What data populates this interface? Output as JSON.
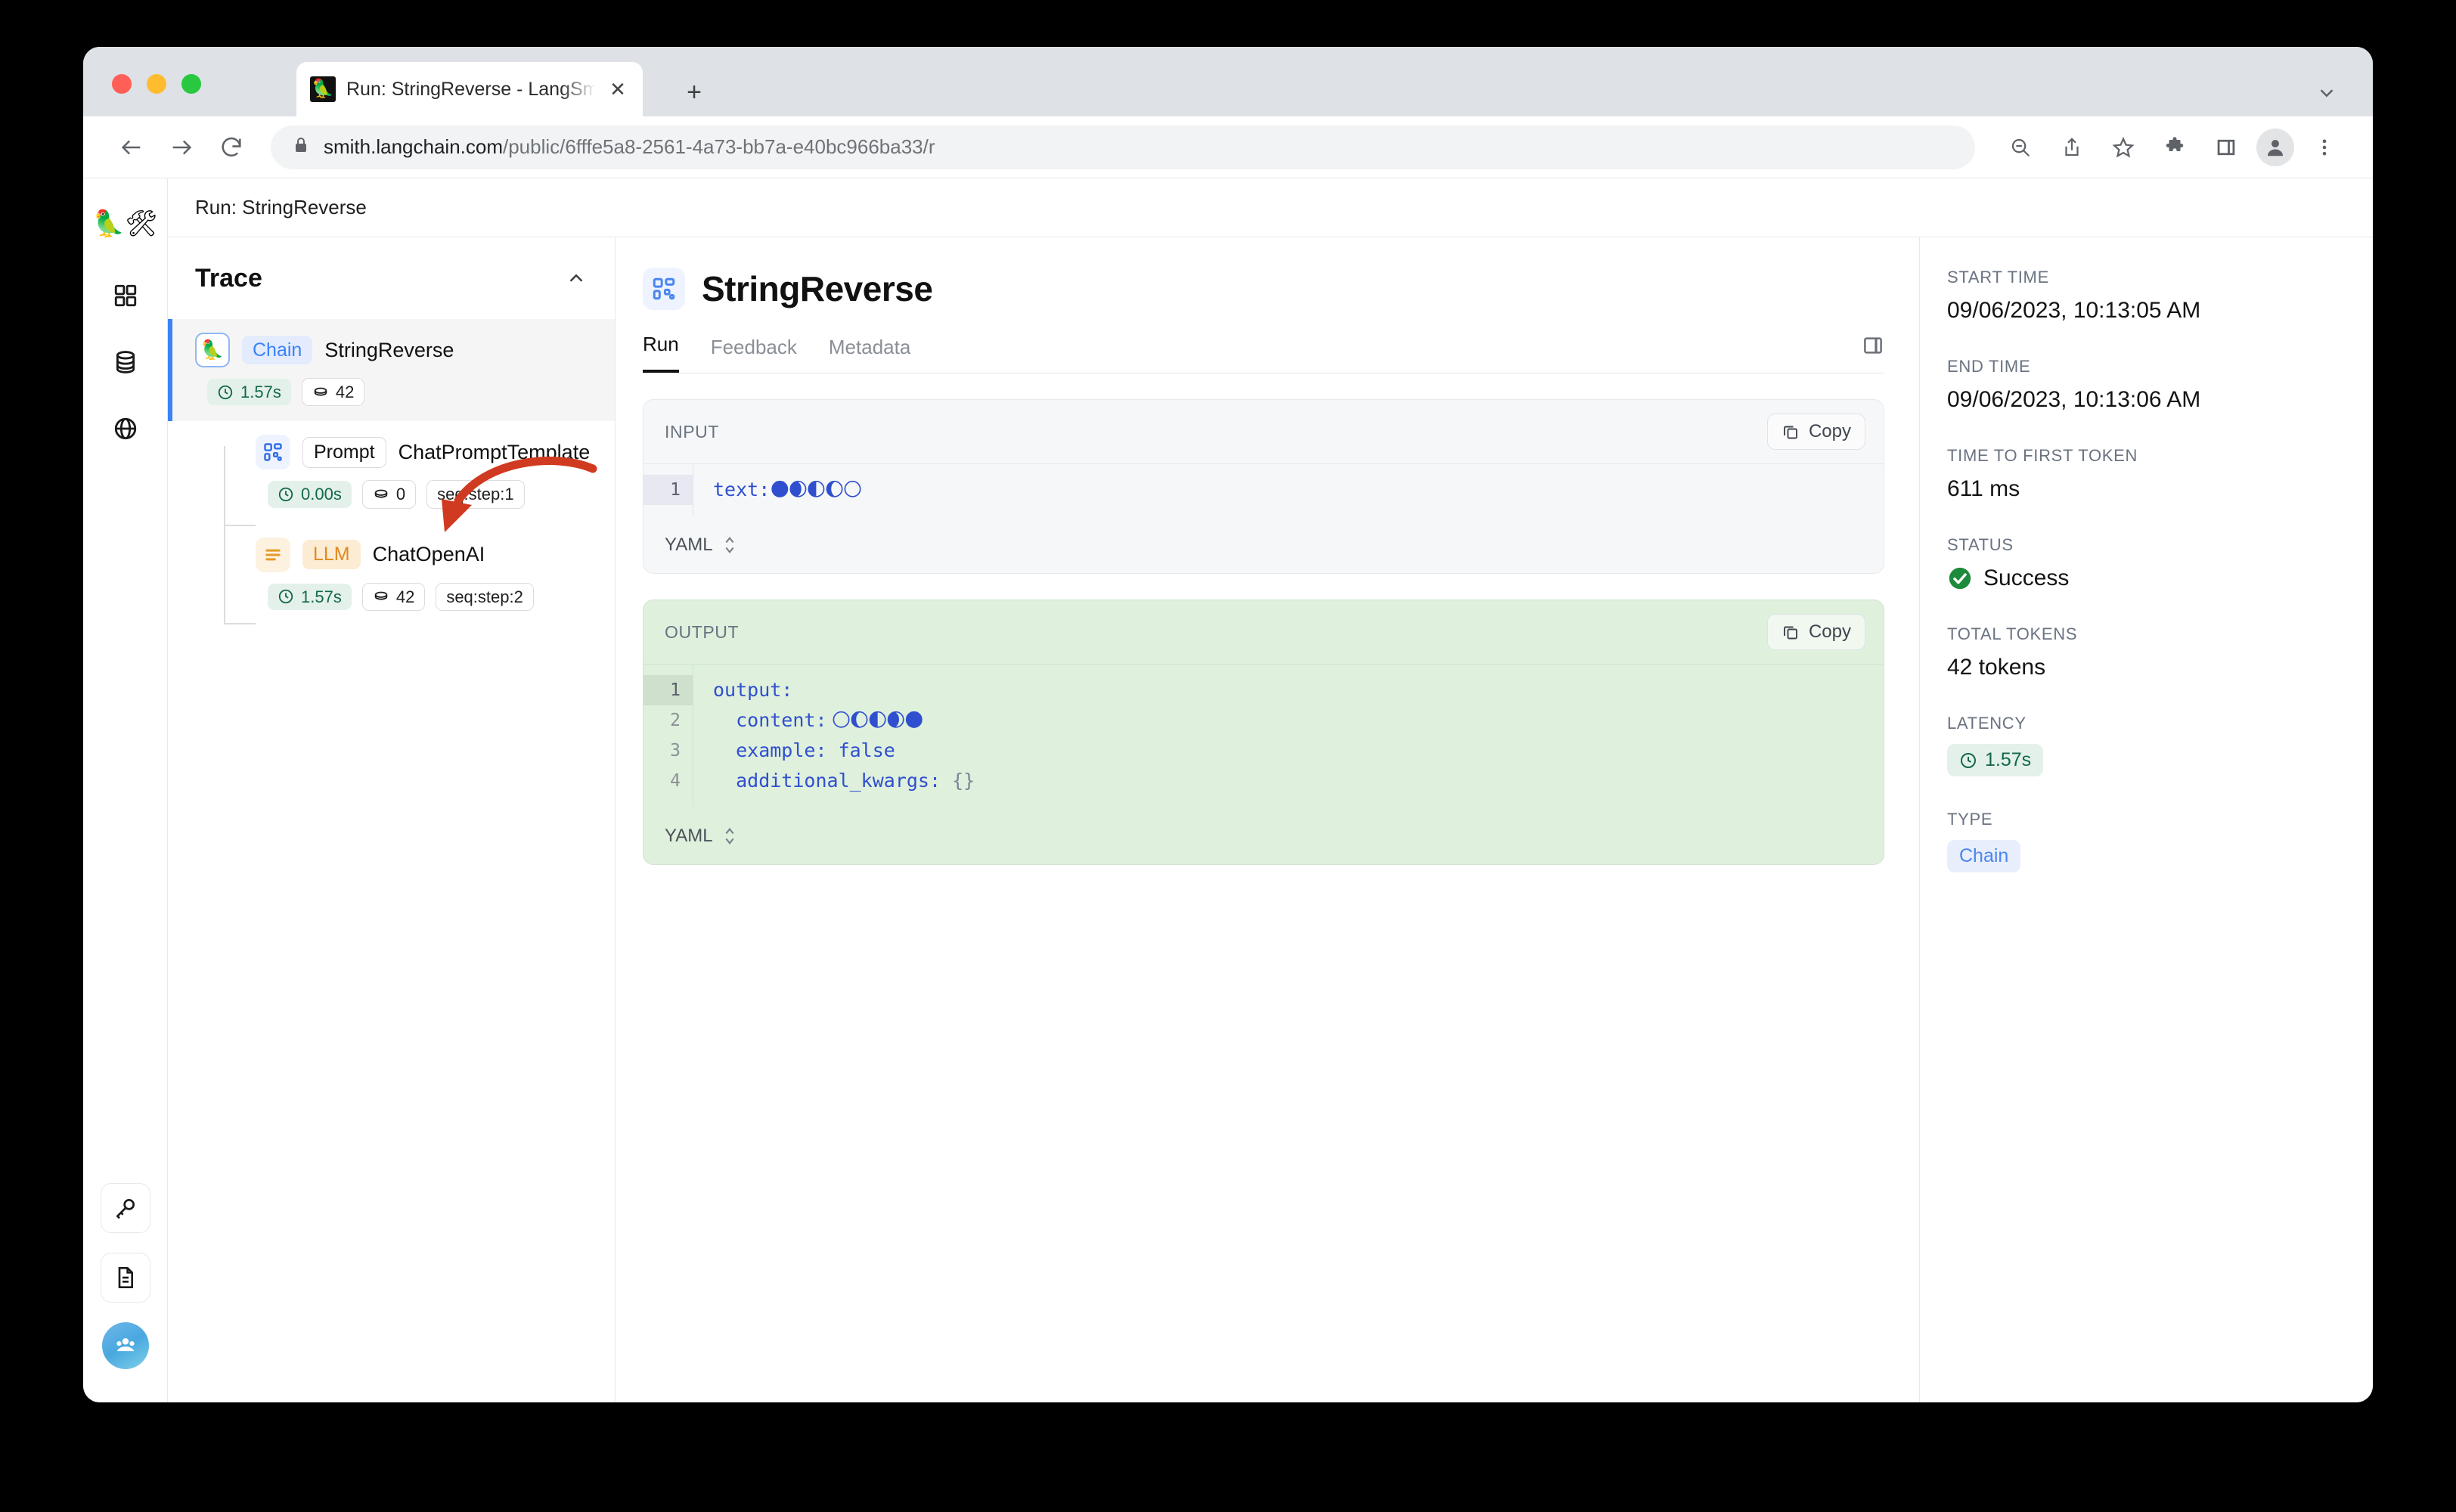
{
  "browser": {
    "tab": {
      "title": "Run: StringReverse - LangSmith",
      "favicon": "🦜",
      "close_label": "✕"
    },
    "new_tab_label": "+",
    "url_prefix": "smith.langchain.com",
    "url_suffix": "/public/6fffe5a8-2561-4a73-bb7a-e40bc966ba33/r",
    "icons": {
      "back": "back-arrow-icon",
      "forward": "forward-arrow-icon",
      "reload": "reload-icon",
      "lock": "lock-icon",
      "zoom_out": "zoom-out-icon",
      "share": "share-icon",
      "bookmark": "star-icon",
      "extensions": "puzzle-icon",
      "side_panel": "side-panel-icon",
      "profile": "profile-avatar-icon",
      "tab_list": "chevron-down-icon"
    }
  },
  "rail": {
    "logo": "🦜🛠",
    "items": [
      {
        "name": "projects",
        "icon": "grid-icon"
      },
      {
        "name": "datasets",
        "icon": "database-icon"
      },
      {
        "name": "hub",
        "icon": "globe-icon"
      }
    ],
    "bottom_items": [
      {
        "name": "api-keys",
        "icon": "key-icon"
      },
      {
        "name": "docs",
        "icon": "document-icon"
      }
    ],
    "avatar": "org-avatar-icon"
  },
  "breadcrumb": "Run: StringReverse",
  "trace": {
    "title": "Trace",
    "collapse_icon": "chevron-up-icon",
    "nodes": [
      {
        "icon": "🦜",
        "icon_kind": "chain",
        "type": "Chain",
        "name": "StringReverse",
        "duration": "1.57s",
        "tokens": "42",
        "seq": null,
        "selected": true
      },
      {
        "icon": "prompt-icon",
        "icon_kind": "prompt",
        "type": "Prompt",
        "name": "ChatPromptTemplate",
        "duration": "0.00s",
        "tokens": "0",
        "seq": "seq:step:1",
        "selected": false
      },
      {
        "icon": "llm-icon",
        "icon_kind": "llm",
        "type": "LLM",
        "name": "ChatOpenAI",
        "duration": "1.57s",
        "tokens": "42",
        "seq": "seq:step:2",
        "selected": false
      }
    ],
    "annotation_arrow_color": "#d03a20"
  },
  "run": {
    "title": "StringReverse",
    "title_icon": "prompt-icon",
    "tabs": [
      {
        "label": "Run",
        "active": true
      },
      {
        "label": "Feedback",
        "active": false
      },
      {
        "label": "Metadata",
        "active": false
      }
    ],
    "panel_toggle_icon": "side-panel-icon",
    "input": {
      "label": "INPUT",
      "copy_label": "Copy",
      "format": "YAML",
      "lines": [
        {
          "no": "1",
          "key": "text:",
          "value": "🌑🌒🌓🌔🌕",
          "active": true
        }
      ]
    },
    "output": {
      "label": "OUTPUT",
      "copy_label": "Copy",
      "format": "YAML",
      "lines": [
        {
          "no": "1",
          "key": "output:",
          "value": "",
          "active": true
        },
        {
          "no": "2",
          "key": "  content:",
          "value": " 🌕🌔🌓🌒🌑",
          "active": false
        },
        {
          "no": "3",
          "key": "  example:",
          "value": " false",
          "active": false
        },
        {
          "no": "4",
          "key": "  additional_kwargs:",
          "value": " {}",
          "active": false
        }
      ]
    }
  },
  "meta": {
    "start_time_label": "START TIME",
    "start_time": "09/06/2023, 10:13:05 AM",
    "end_time_label": "END TIME",
    "end_time": "09/06/2023, 10:13:06 AM",
    "ttft_label": "TIME TO FIRST TOKEN",
    "ttft": "611 ms",
    "status_label": "STATUS",
    "status": "Success",
    "status_color": "#1e8a3c",
    "tokens_label": "TOTAL TOKENS",
    "tokens": "42 tokens",
    "latency_label": "LATENCY",
    "latency": "1.57s",
    "type_label": "TYPE",
    "type": "Chain"
  }
}
